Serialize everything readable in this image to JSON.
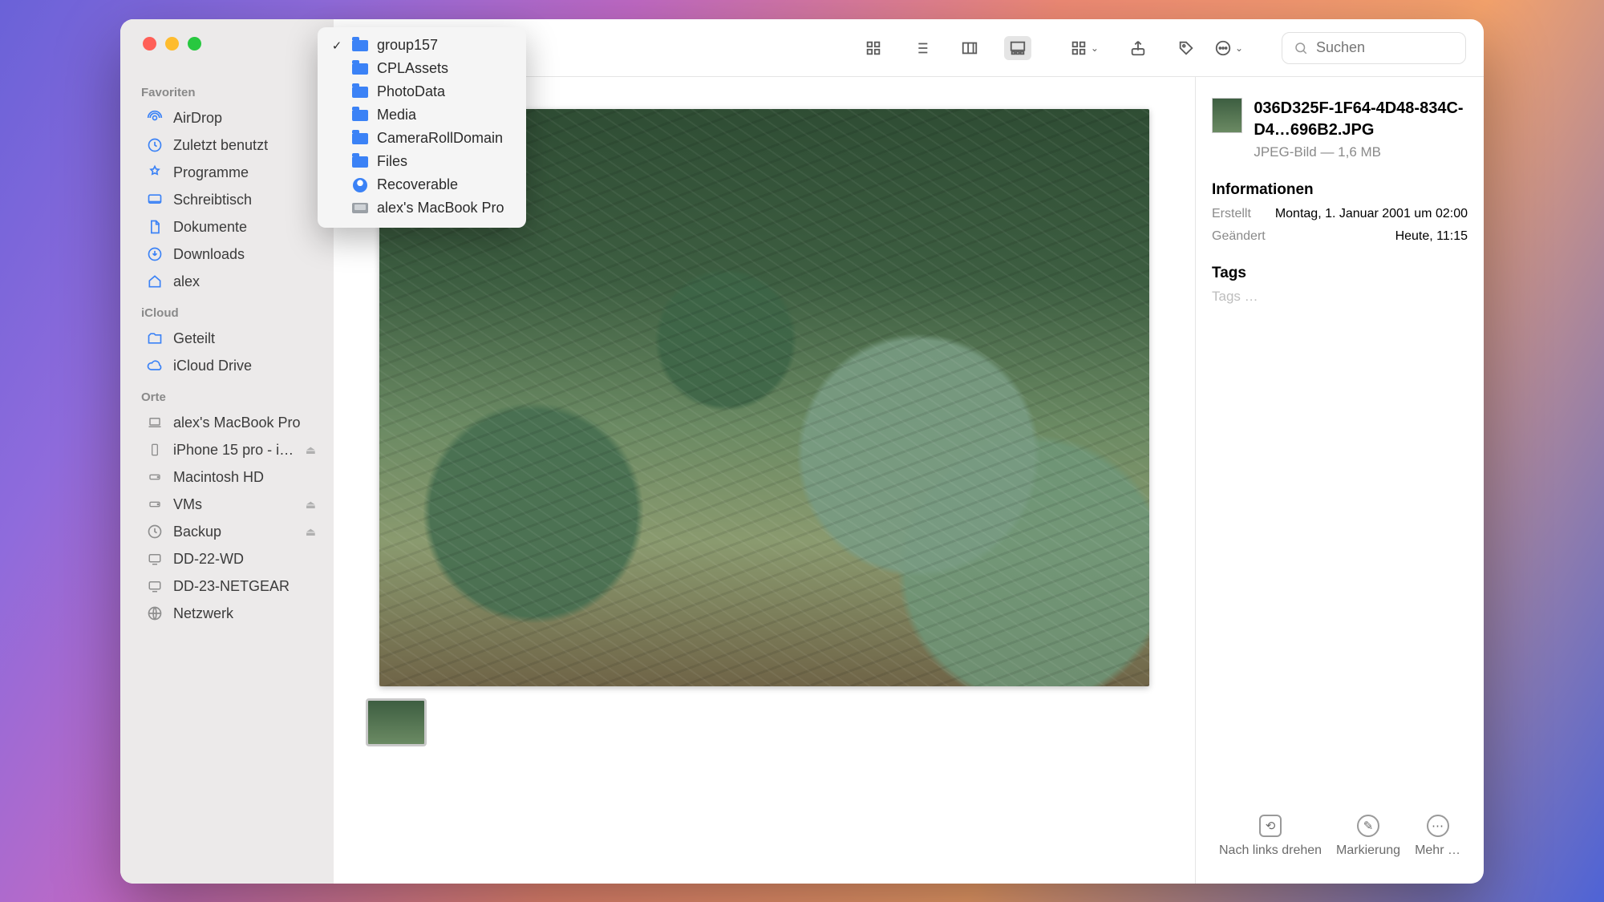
{
  "sidebar": {
    "sections": {
      "favoriten": {
        "title": "Favoriten",
        "items": [
          {
            "label": "AirDrop"
          },
          {
            "label": "Zuletzt benutzt"
          },
          {
            "label": "Programme"
          },
          {
            "label": "Schreibtisch"
          },
          {
            "label": "Dokumente"
          },
          {
            "label": "Downloads"
          },
          {
            "label": "alex"
          }
        ]
      },
      "icloud": {
        "title": "iCloud",
        "items": [
          {
            "label": "Geteilt"
          },
          {
            "label": "iCloud Drive"
          }
        ]
      },
      "orte": {
        "title": "Orte",
        "items": [
          {
            "label": "alex's MacBook Pro"
          },
          {
            "label": "iPhone 15 pro - i…",
            "eject": true
          },
          {
            "label": "Macintosh HD"
          },
          {
            "label": "VMs",
            "eject": true
          },
          {
            "label": "Backup",
            "eject": true
          },
          {
            "label": "DD-22-WD"
          },
          {
            "label": "DD-23-NETGEAR"
          },
          {
            "label": "Netzwerk"
          }
        ]
      }
    }
  },
  "breadcrumb": {
    "items": [
      {
        "label": "group157",
        "type": "folder",
        "current": true
      },
      {
        "label": "CPLAssets",
        "type": "folder"
      },
      {
        "label": "PhotoData",
        "type": "folder"
      },
      {
        "label": "Media",
        "type": "folder"
      },
      {
        "label": "CameraRollDomain",
        "type": "folder"
      },
      {
        "label": "Files",
        "type": "folder"
      },
      {
        "label": "Recoverable",
        "type": "recoverable"
      },
      {
        "label": "alex's MacBook Pro",
        "type": "mac"
      }
    ]
  },
  "search": {
    "placeholder": "Suchen"
  },
  "info": {
    "filename": "036D325F-1F64-4D48-834C-D4…696B2.JPG",
    "kind_size": "JPEG-Bild — 1,6 MB",
    "section_info": "Informationen",
    "created_k": "Erstellt",
    "created_v": "Montag, 1. Januar 2001 um 02:00",
    "modified_k": "Geändert",
    "modified_v": "Heute, 11:15",
    "tags_h": "Tags",
    "tags_ph": "Tags …"
  },
  "quick_actions": {
    "rotate": "Nach links drehen",
    "markup": "Markierung",
    "more": "Mehr …"
  }
}
